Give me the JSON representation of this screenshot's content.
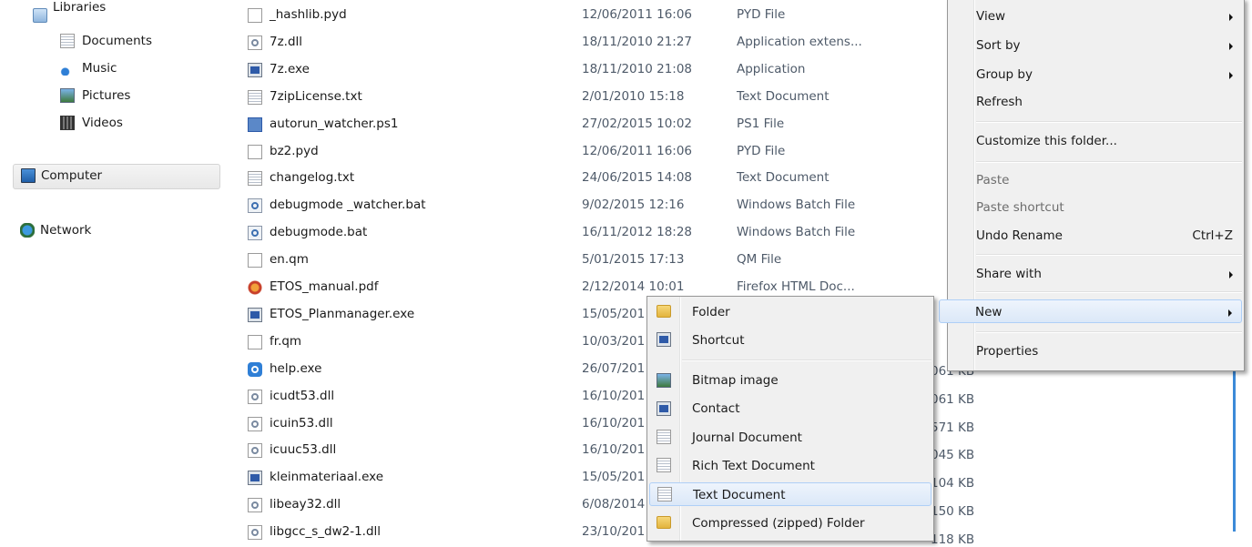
{
  "nav": {
    "libraries": "Libraries",
    "documents": "Documents",
    "music": "Music",
    "pictures": "Pictures",
    "videos": "Videos",
    "computer": "Computer",
    "network": "Network"
  },
  "files": [
    {
      "name": "_hashlib.pyd",
      "date": "12/06/2011 16:06",
      "type": "PYD File",
      "icon": "blank"
    },
    {
      "name": "7z.dll",
      "date": "18/11/2010 21:27",
      "type": "Application extens...",
      "icon": "dll"
    },
    {
      "name": "7z.exe",
      "date": "18/11/2010 21:08",
      "type": "Application",
      "icon": "exe"
    },
    {
      "name": "7zipLicense.txt",
      "date": "2/01/2010 15:18",
      "type": "Text Document",
      "icon": "txt"
    },
    {
      "name": "autorun_watcher.ps1",
      "date": "27/02/2015 10:02",
      "type": "PS1 File",
      "icon": "ps1"
    },
    {
      "name": "bz2.pyd",
      "date": "12/06/2011 16:06",
      "type": "PYD File",
      "icon": "blank"
    },
    {
      "name": "changelog.txt",
      "date": "24/06/2015 14:08",
      "type": "Text Document",
      "icon": "txt"
    },
    {
      "name": "debugmode _watcher.bat",
      "date": "9/02/2015 12:16",
      "type": "Windows Batch File",
      "icon": "bat"
    },
    {
      "name": "debugmode.bat",
      "date": "16/11/2012 18:28",
      "type": "Windows Batch File",
      "icon": "bat"
    },
    {
      "name": "en.qm",
      "date": "5/01/2015 17:13",
      "type": "QM File",
      "icon": "blank"
    },
    {
      "name": "ETOS_manual.pdf",
      "date": "2/12/2014 10:01",
      "type": "Firefox HTML Doc...",
      "icon": "pdf"
    },
    {
      "name": "ETOS_Planmanager.exe",
      "date": "15/05/201",
      "type": "",
      "icon": "exe"
    },
    {
      "name": "fr.qm",
      "date": "10/03/201",
      "type": "",
      "icon": "blank"
    },
    {
      "name": "help.exe",
      "date": "26/07/201",
      "type": "",
      "icon": "help"
    },
    {
      "name": "icudt53.dll",
      "date": "16/10/201",
      "type": "",
      "icon": "dll"
    },
    {
      "name": "icuin53.dll",
      "date": "16/10/201",
      "type": "",
      "icon": "dll"
    },
    {
      "name": "icuuc53.dll",
      "date": "16/10/201",
      "type": "",
      "icon": "dll"
    },
    {
      "name": "kleinmateriaal.exe",
      "date": "15/05/201",
      "type": "",
      "icon": "exe"
    },
    {
      "name": "libeay32.dll",
      "date": "6/08/2014",
      "type": "",
      "icon": "dll"
    },
    {
      "name": "libgcc_s_dw2-1.dll",
      "date": "23/10/201",
      "type": "",
      "icon": "dll"
    }
  ],
  "sizes": [
    "061 KB",
    "061 KB",
    "571 KB",
    "045 KB",
    "104 KB",
    "150 KB",
    "118 KB"
  ],
  "context_menu": {
    "view": "View",
    "sort_by": "Sort by",
    "group_by": "Group by",
    "refresh": "Refresh",
    "customize": "Customize this folder...",
    "paste": "Paste",
    "paste_shortcut": "Paste shortcut",
    "undo_rename": "Undo Rename",
    "undo_shortcut": "Ctrl+Z",
    "share_with": "Share with",
    "new": "New",
    "properties": "Properties"
  },
  "new_submenu": {
    "folder": "Folder",
    "shortcut": "Shortcut",
    "bitmap": "Bitmap image",
    "contact": "Contact",
    "journal": "Journal Document",
    "rtf": "Rich Text Document",
    "text": "Text Document",
    "zip": "Compressed (zipped) Folder"
  },
  "colors": {
    "highlight_border": "#aecff7",
    "menu_bg": "#f0f0f0",
    "detail_text": "#4e5a69"
  }
}
